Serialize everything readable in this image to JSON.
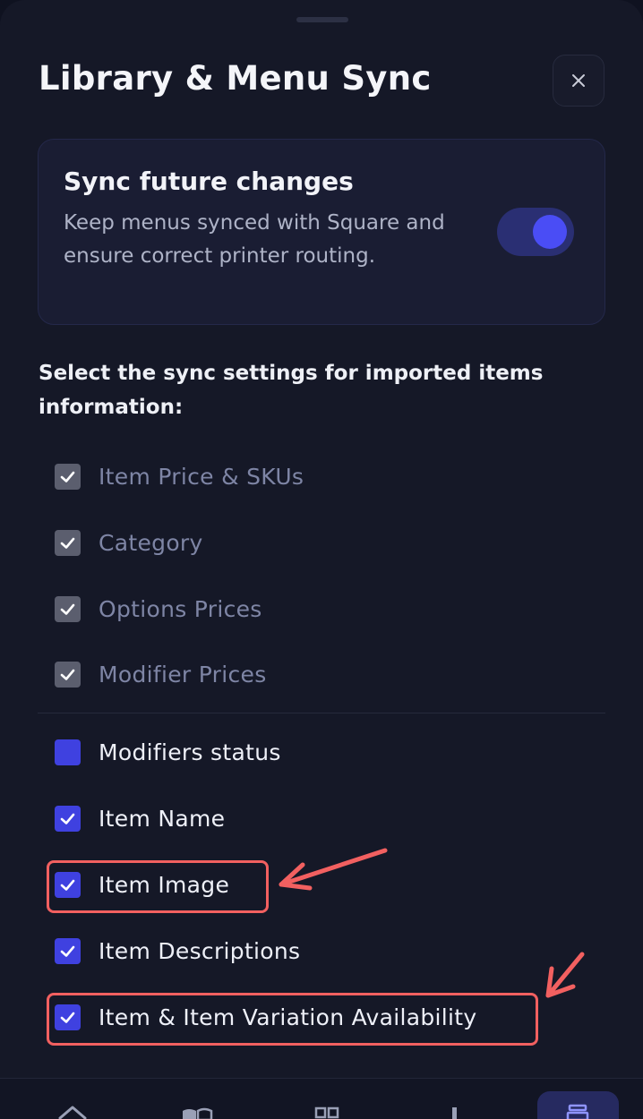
{
  "header": {
    "title": "Library & Menu Sync",
    "close_icon": "close-icon"
  },
  "sync_card": {
    "title": "Sync future changes",
    "description": "Keep menus synced with Square and ensure correct printer routing.",
    "toggle_on": true
  },
  "prompt": "Select the sync settings for imported items information:",
  "locked_options": [
    {
      "label": "Item Price & SKUs",
      "checked": true
    },
    {
      "label": "Category",
      "checked": true
    },
    {
      "label": "Options Prices",
      "checked": true
    },
    {
      "label": "Modifier Prices",
      "checked": true
    }
  ],
  "options": [
    {
      "label": "Modifiers status",
      "checked": false
    },
    {
      "label": "Item Name",
      "checked": true
    },
    {
      "label": "Item Image",
      "checked": true,
      "highlighted": true
    },
    {
      "label": "Item Descriptions",
      "checked": true
    },
    {
      "label": "Item & Item Variation Availability",
      "checked": true,
      "highlighted": true
    }
  ],
  "bottom_nav": {
    "items": [
      "home-icon",
      "menu-book-icon",
      "grid-icon",
      "bar-chart-icon",
      "printer-icon"
    ],
    "active": "printer-icon"
  },
  "colors": {
    "accent": "#3f41e0",
    "annotation": "#f26060",
    "background": "#151827"
  }
}
